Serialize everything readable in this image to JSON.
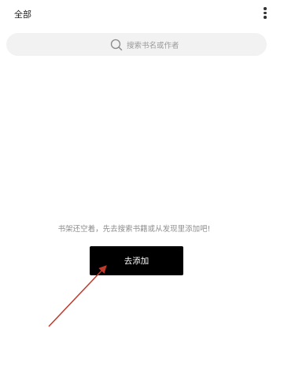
{
  "header": {
    "title": "全部",
    "menu_icon": "more-vertical-icon"
  },
  "search": {
    "icon": "search-icon",
    "placeholder": "搜索书名或作者"
  },
  "empty_state": {
    "message": "书架还空着，先去搜索书籍或从发现里添加吧!",
    "button_label": "去添加"
  },
  "annotation": {
    "arrow_color": "#c0392b"
  },
  "colors": {
    "button_bg": "#000000",
    "search_bg": "#f2f2f2",
    "hint_text": "#8e8e8e"
  }
}
